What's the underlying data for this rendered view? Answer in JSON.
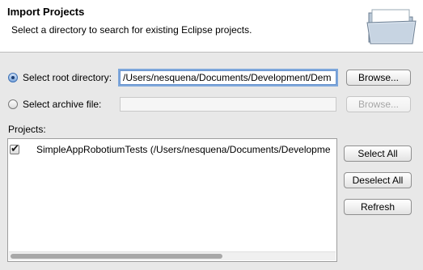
{
  "header": {
    "title": "Import Projects",
    "description": "Select a directory to search for existing Eclipse projects."
  },
  "root_option": {
    "label": "Select root directory:",
    "selected": true,
    "path_value": "/Users/nesquena/Documents/Development/Dem",
    "browse_label": "Browse..."
  },
  "archive_option": {
    "label": "Select archive file:",
    "selected": false,
    "path_value": "",
    "browse_label": "Browse..."
  },
  "projects": {
    "label": "Projects:",
    "items": [
      {
        "checked": true,
        "text": "SimpleAppRobotiumTests (/Users/nesquena/Documents/Developme"
      }
    ]
  },
  "actions": {
    "select_all": "Select All",
    "deselect_all": "Deselect All",
    "refresh": "Refresh"
  },
  "icons": {
    "header_icon": "folder-icon"
  }
}
